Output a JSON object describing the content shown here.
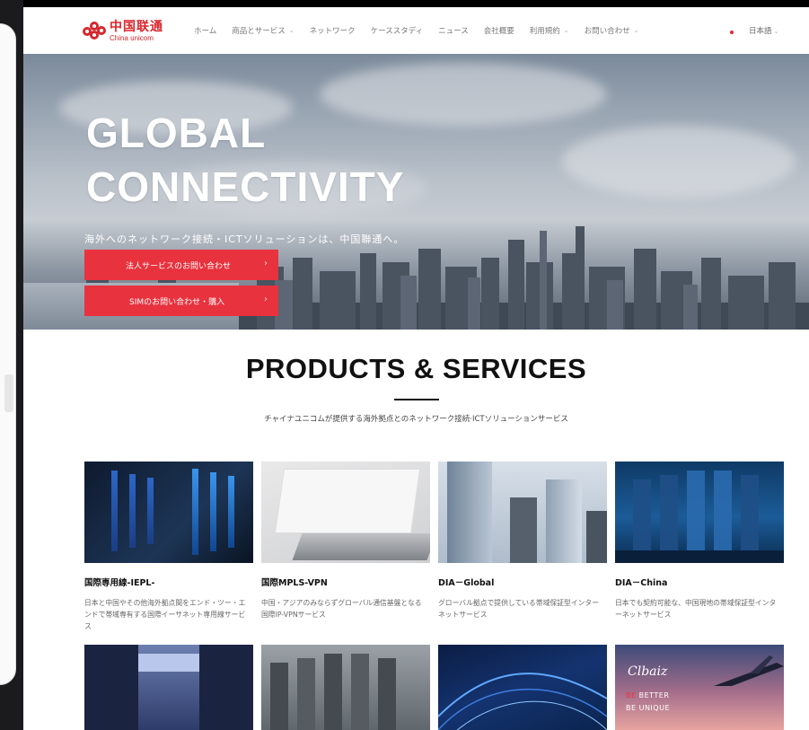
{
  "brand": {
    "cn": "中国联通",
    "en": "China unicom"
  },
  "nav": {
    "items": [
      {
        "label": "ホーム",
        "dropdown": false
      },
      {
        "label": "商品とサービス",
        "dropdown": true
      },
      {
        "label": "ネットワーク",
        "dropdown": false
      },
      {
        "label": "ケーススタディ",
        "dropdown": false
      },
      {
        "label": "ニュース",
        "dropdown": false
      },
      {
        "label": "会社概要",
        "dropdown": false
      },
      {
        "label": "利用規約",
        "dropdown": true
      },
      {
        "label": "お問い合わせ",
        "dropdown": true
      }
    ],
    "language": "日本語"
  },
  "hero": {
    "title_line1": "GLOBAL",
    "title_line2": "CONNECTIVITY",
    "subtitle": "海外へのネットワーク接続・ICTソリューションは、中国聯通へ。",
    "cta_business": "法人サービスのお問い合わせ",
    "cta_sim": "SIMのお問い合わせ・購入",
    "cta_arrow": "›"
  },
  "products": {
    "title": "PRODUCTS & SERVICES",
    "subtitle": "チャイナユニコムが提供する海外拠点とのネットワーク接続·ICTソリューションサービス",
    "cards": [
      {
        "name": "国際専用線-IEPL-",
        "desc": "日本と中国やその他海外拠点間をエンド・ツー・エンドで帯域専有する国際イーサネット専用線サービス"
      },
      {
        "name": "国際MPLS-VPN",
        "desc": "中国・アジアのみならずグローバル通信基盤となる国際IP-VPNサービス"
      },
      {
        "name": "DIA－Global",
        "desc": "グローバル拠点で提供している帯域保証型インターネットサービス"
      },
      {
        "name": "DIA－China",
        "desc": "日本でも契約可能な、中国現地の帯域保証型インターネットサービス"
      }
    ],
    "promo": {
      "script": "Clbaiz",
      "line1_red": "BE",
      "line1_rest": " BETTER",
      "line2": "BE UNIQUE"
    }
  },
  "colors": {
    "accent": "#e8323e",
    "brand_red": "#d8262c"
  }
}
